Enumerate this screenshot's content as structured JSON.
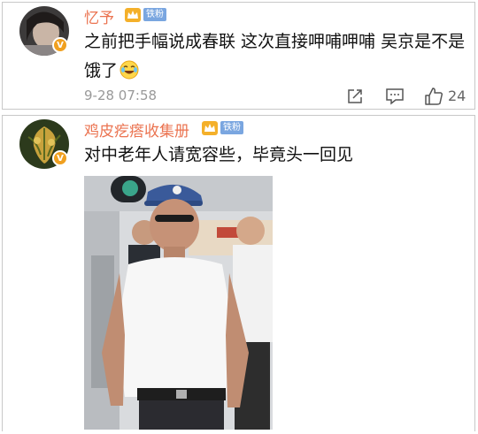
{
  "comments": [
    {
      "username": "忆予",
      "fan_badge": "铁粉",
      "verified_badge": "V",
      "text": "之前把手幅说成春联 这次直接呷哺呷哺 吴京是不是饿了",
      "timestamp": "9-28 07:58",
      "like_count": "24",
      "emoji_icon": "laugh-cry-icon"
    },
    {
      "username": "鸡皮疙瘩收集册",
      "fan_badge": "铁粉",
      "verified_badge": "V",
      "text": "对中老年人请宽容些，毕竟头一回见"
    }
  ],
  "colors": {
    "username": "#eb7350",
    "fan_badge": "#7aa6e0",
    "verified_badge": "#f0a020",
    "meta_gray": "#999999"
  }
}
